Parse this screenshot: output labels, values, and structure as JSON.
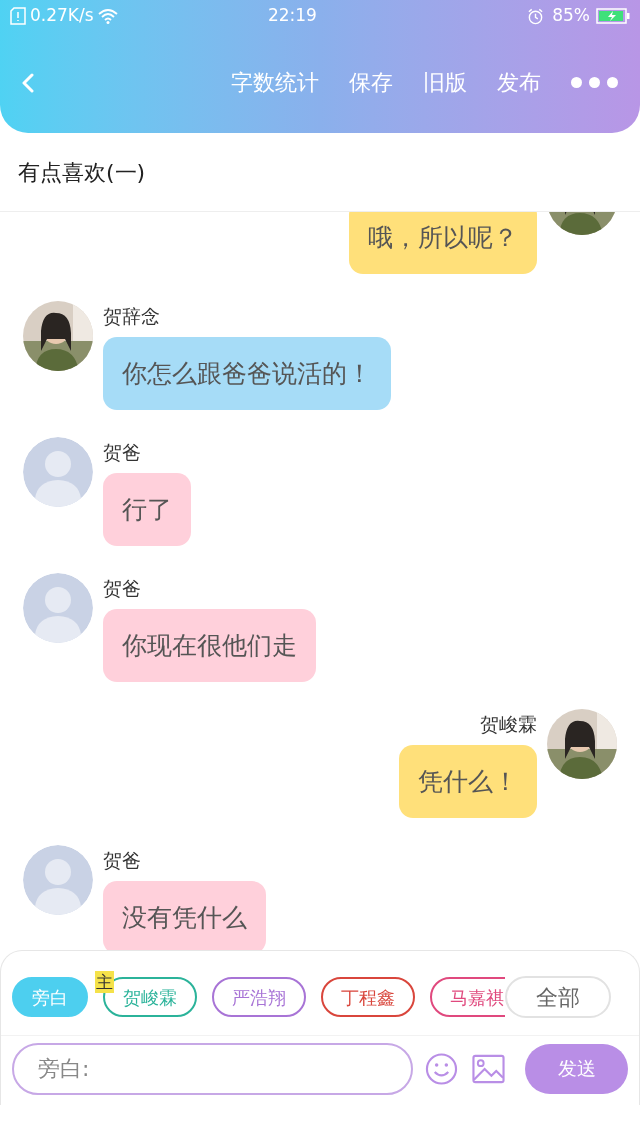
{
  "status_bar": {
    "speed": "0.27K/s",
    "time": "22:19",
    "battery": "85%"
  },
  "header": {
    "actions": [
      "字数统计",
      "保存",
      "旧版",
      "发布"
    ]
  },
  "title": "有点喜欢(一)",
  "messages": [
    {
      "kind": "outgoing",
      "has_photo": true,
      "text": "哦，所以呢？",
      "color": "#ffe07a"
    },
    {
      "kind": "incoming",
      "has_photo": true,
      "name": "贺辞念",
      "text": "你怎么跟爸爸说活的！",
      "color": "#a6dcf7"
    },
    {
      "kind": "incoming",
      "has_photo": false,
      "name": "贺爸",
      "text": "行了",
      "color": "#ffd0db"
    },
    {
      "kind": "incoming",
      "has_photo": false,
      "name": "贺爸",
      "text": "你现在很他们走",
      "color": "#ffd0db"
    },
    {
      "kind": "outgoing",
      "has_photo": true,
      "name": "贺峻霖",
      "text": "凭什么！",
      "color": "#ffe07a"
    },
    {
      "kind": "incoming",
      "has_photo": false,
      "name": "贺爸",
      "text": "没有凭什么",
      "color": "#ffd0db"
    }
  ],
  "roles": [
    {
      "label": "旁白",
      "color": "#4dcfef",
      "selected": true
    },
    {
      "label": "贺峻霖",
      "color": "#2bb39a",
      "selected": false,
      "badge": "主"
    },
    {
      "label": "严浩翔",
      "color": "#a874d6",
      "selected": false
    },
    {
      "label": "丁程鑫",
      "color": "#d9463c",
      "selected": false
    },
    {
      "label": "马嘉祺",
      "color": "#e0497e",
      "selected": false
    }
  ],
  "all_button": "全部",
  "input": {
    "placeholder": "旁白:"
  },
  "send_button": "发送"
}
